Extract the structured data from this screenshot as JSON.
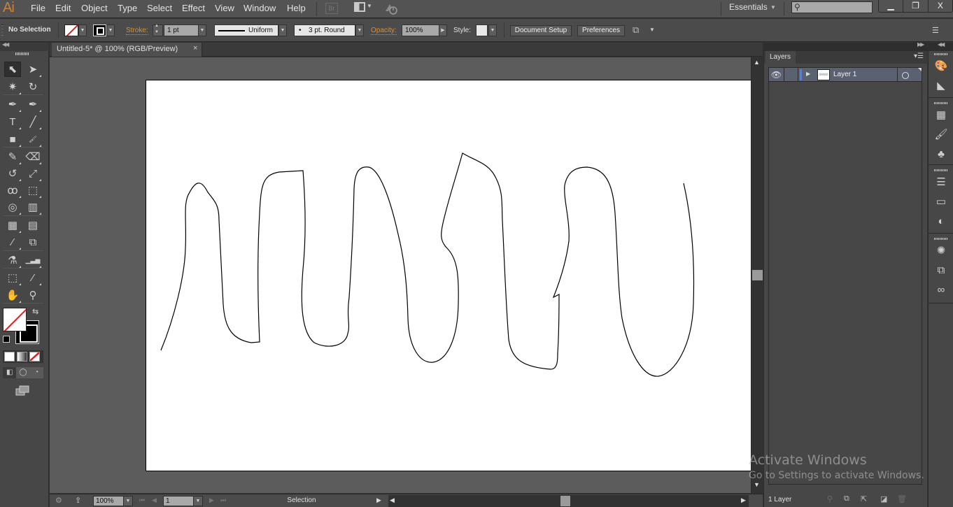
{
  "app": {
    "logo": "Ai",
    "menu": [
      "File",
      "Edit",
      "Object",
      "Type",
      "Select",
      "Effect",
      "View",
      "Window",
      "Help"
    ],
    "bridge_badge": "Br",
    "workspace": "Essentials",
    "search_placeholder": "",
    "window_controls": {
      "minimize": "▁",
      "restore": "❐",
      "close": "X"
    }
  },
  "control_bar": {
    "selection_label": "No Selection",
    "stroke_label": "Stroke:",
    "stroke_weight": "1 pt",
    "profile_label": "Uniform",
    "brush_label": "3 pt. Round",
    "brush_dot": "•",
    "opacity_label": "Opacity:",
    "opacity_value": "100%",
    "style_label": "Style:",
    "document_setup": "Document Setup",
    "preferences": "Preferences",
    "fill_color": "none",
    "stroke_color": "#000000"
  },
  "document": {
    "tab_title": "Untitled-5* @ 100% (RGB/Preview)",
    "tab_close": "×"
  },
  "tools": [
    {
      "name": "selection-tool",
      "glyph": "⬉",
      "active": true
    },
    {
      "name": "direct-selection-tool",
      "glyph": "➤"
    },
    {
      "name": "magic-wand-tool",
      "glyph": "✷"
    },
    {
      "name": "lasso-tool",
      "glyph": "↻"
    },
    {
      "name": "pen-tool",
      "glyph": "✒"
    },
    {
      "name": "curvature-tool",
      "glyph": "✒"
    },
    {
      "name": "type-tool",
      "glyph": "T"
    },
    {
      "name": "line-segment-tool",
      "glyph": "╱"
    },
    {
      "name": "rectangle-tool",
      "glyph": "■"
    },
    {
      "name": "paintbrush-tool",
      "glyph": "🖌"
    },
    {
      "name": "pencil-tool",
      "glyph": "✎"
    },
    {
      "name": "eraser-tool",
      "glyph": "⌫"
    },
    {
      "name": "rotate-tool",
      "glyph": "↺"
    },
    {
      "name": "scale-tool",
      "glyph": "⤢"
    },
    {
      "name": "warp-tool",
      "glyph": "ꝏ"
    },
    {
      "name": "free-transform-tool",
      "glyph": "⬚"
    },
    {
      "name": "shape-builder-tool",
      "glyph": "◎"
    },
    {
      "name": "perspective-grid-tool",
      "glyph": "▥"
    },
    {
      "name": "mesh-tool",
      "glyph": "▦"
    },
    {
      "name": "gradient-tool",
      "glyph": "▤"
    },
    {
      "name": "eyedropper-tool",
      "glyph": "⁄"
    },
    {
      "name": "blend-tool",
      "glyph": "⧉"
    },
    {
      "name": "symbol-sprayer-tool",
      "glyph": "⚗"
    },
    {
      "name": "column-graph-tool",
      "glyph": "▁▃▅"
    },
    {
      "name": "artboard-tool",
      "glyph": "⬚"
    },
    {
      "name": "slice-tool",
      "glyph": "⁄"
    },
    {
      "name": "hand-tool",
      "glyph": "✋"
    },
    {
      "name": "zoom-tool",
      "glyph": "⚲"
    }
  ],
  "tools_bottom": {
    "swap": "⇆",
    "draw_modes": [
      "◧",
      "◯",
      "◔"
    ]
  },
  "status_bar": {
    "zoom": "100%",
    "artboard_number": "1",
    "current_tool": "Selection"
  },
  "layers_panel": {
    "tab": "Layers",
    "layers": [
      {
        "name": "Layer 1",
        "visible": true,
        "color": "#4f7cff",
        "thumbnail": "ʍʍʍ"
      }
    ],
    "count_label": "1 Layer"
  },
  "dock_icons": [
    "color-icon",
    "color-guide-icon",
    "swatches-icon",
    "brushes-icon",
    "symbols-icon",
    "stroke-icon",
    "gradient-icon",
    "transparency-icon",
    "appearance-icon",
    "graphic-styles-icon",
    "creative-cloud-libraries-icon"
  ],
  "watermark": {
    "line1": "Activate Windows",
    "line2": "Go to Settings to activate Windows."
  },
  "drawing": {
    "stroke_color": "#000000",
    "description": "freehand wavy open path across artboard"
  }
}
